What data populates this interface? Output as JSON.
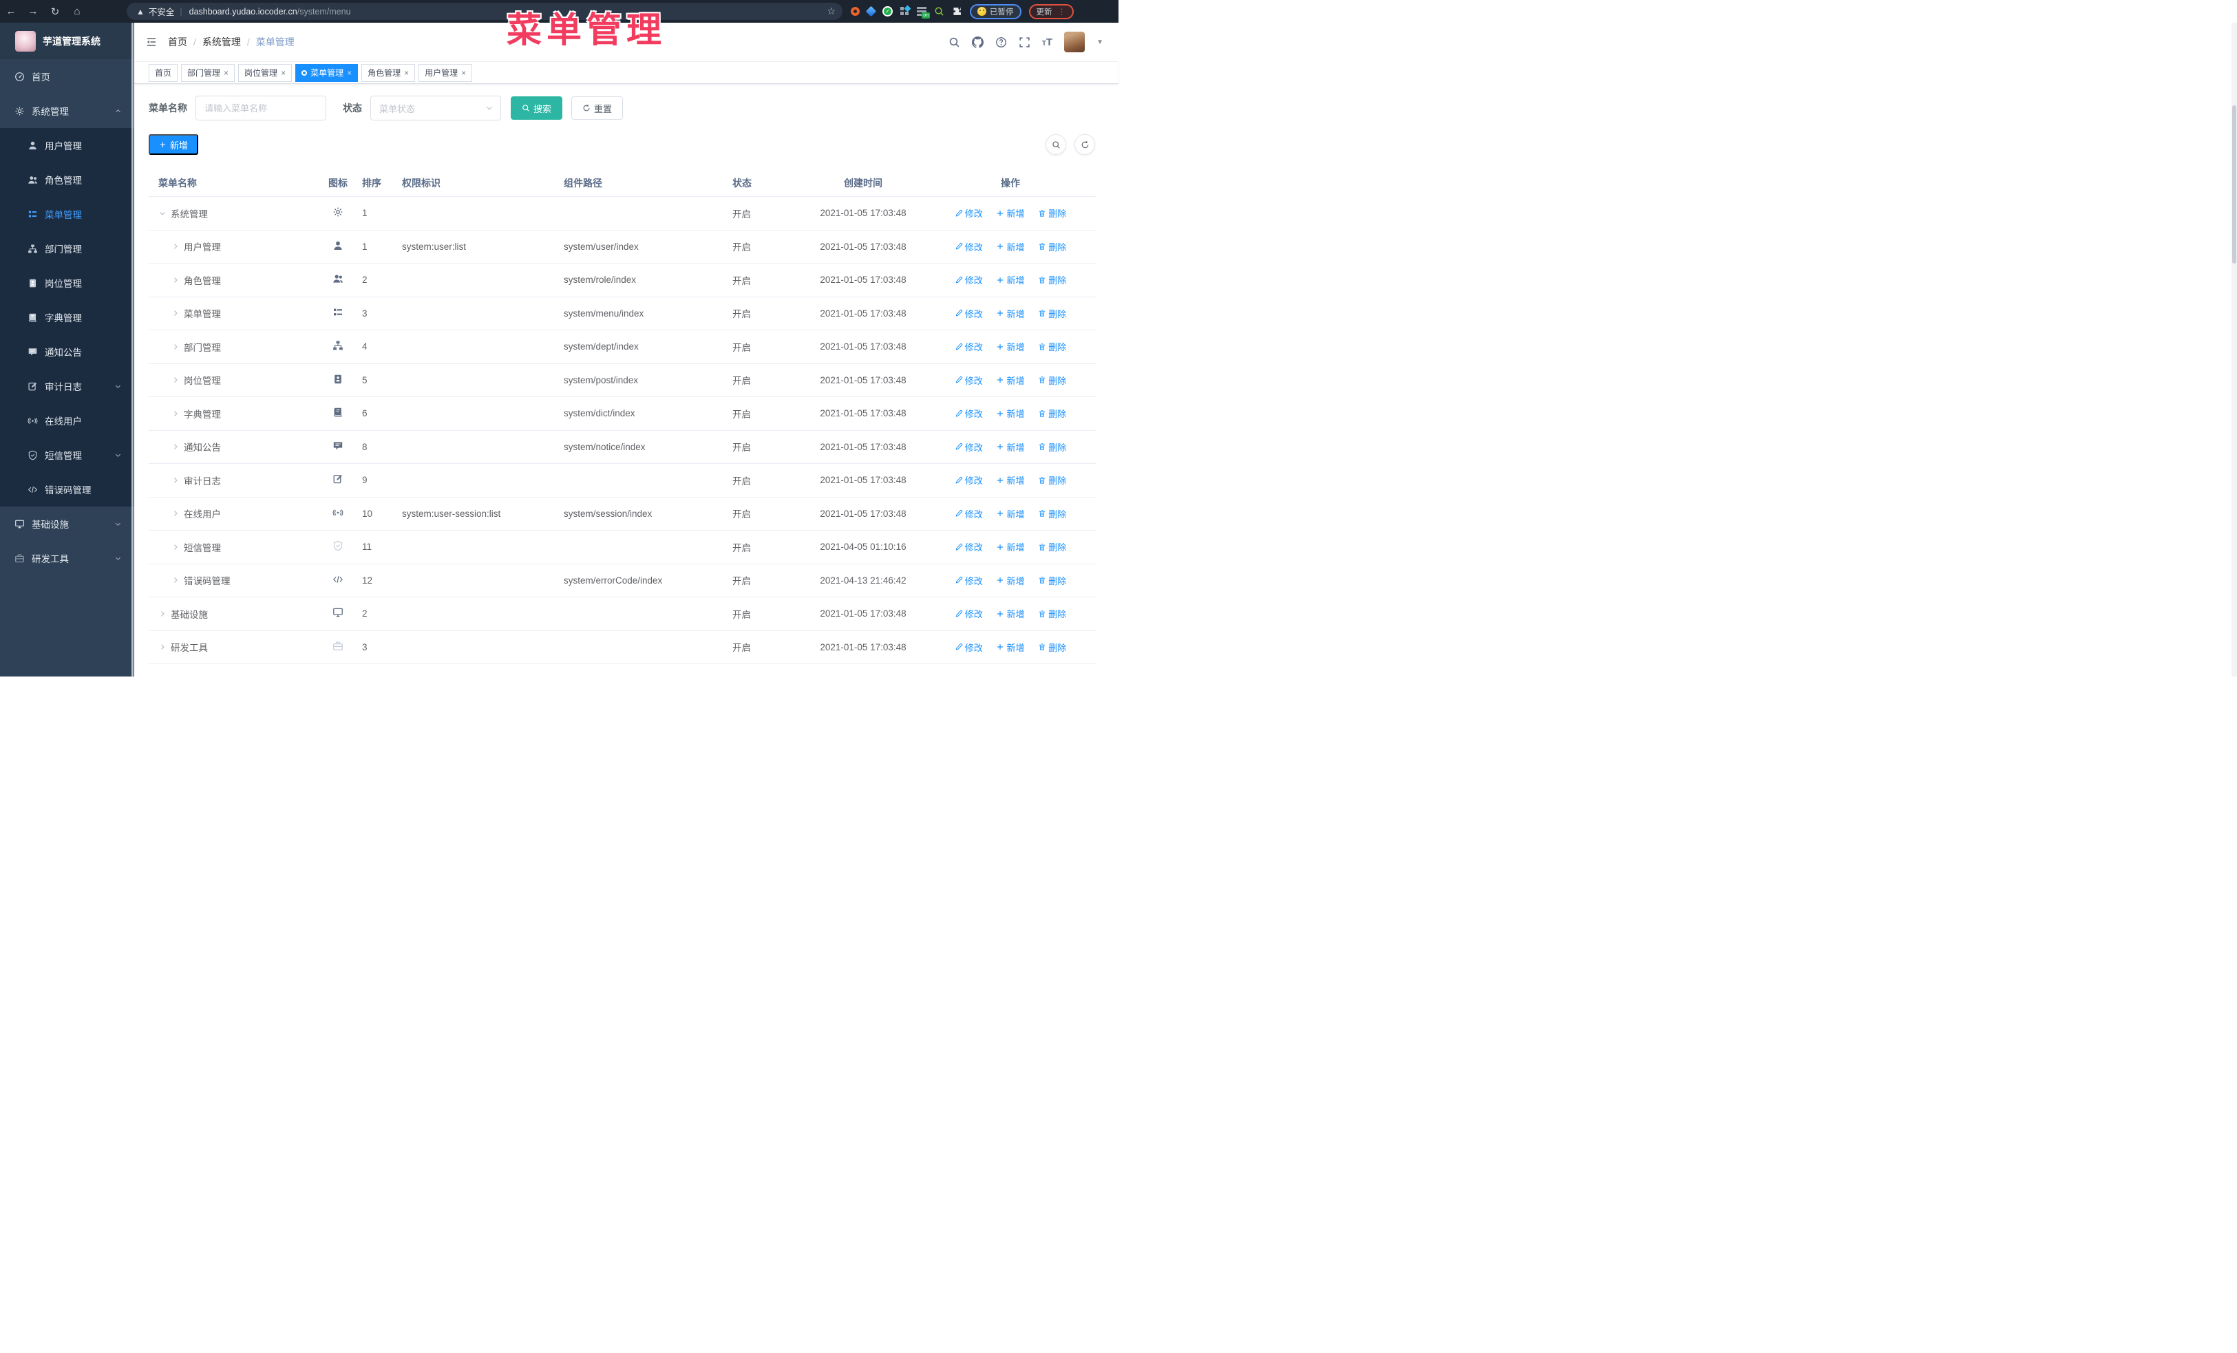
{
  "browser": {
    "security_warning": "不安全",
    "url_host": "dashboard.yudao.iocoder.cn",
    "url_path": "/system/menu",
    "paused_badge": "已暂停",
    "update_badge": "更新",
    "on_badge": "on"
  },
  "annotation": {
    "title": "菜单管理"
  },
  "colors": {
    "primary": "#1890ff",
    "sidebar_active": "#409eff",
    "search_button": "#2cb6a3",
    "annotation_pink": "#f13c5f"
  },
  "sidebar": {
    "logo_title": "芋道管理系统",
    "items": [
      {
        "label": "首页",
        "icon": "dashboard",
        "level": 0,
        "active": false,
        "caret": "",
        "light": false
      },
      {
        "label": "系统管理",
        "icon": "gear",
        "level": 0,
        "active": false,
        "caret": "up",
        "light": false
      },
      {
        "label": "用户管理",
        "icon": "user",
        "level": 1,
        "active": false,
        "caret": "",
        "light": false
      },
      {
        "label": "角色管理",
        "icon": "users",
        "level": 1,
        "active": false,
        "caret": "",
        "light": false
      },
      {
        "label": "菜单管理",
        "icon": "menulist",
        "level": 1,
        "active": true,
        "caret": "",
        "light": false
      },
      {
        "label": "部门管理",
        "icon": "tree",
        "level": 1,
        "active": false,
        "caret": "",
        "light": false
      },
      {
        "label": "岗位管理",
        "icon": "post",
        "level": 1,
        "active": false,
        "caret": "",
        "light": false
      },
      {
        "label": "字典管理",
        "icon": "dict",
        "level": 1,
        "active": false,
        "caret": "",
        "light": false
      },
      {
        "label": "通知公告",
        "icon": "message",
        "level": 1,
        "active": false,
        "caret": "",
        "light": false
      },
      {
        "label": "审计日志",
        "icon": "log",
        "level": 1,
        "active": false,
        "caret": "down",
        "light": false
      },
      {
        "label": "在线用户",
        "icon": "online",
        "level": 1,
        "active": false,
        "caret": "",
        "light": false
      },
      {
        "label": "短信管理",
        "icon": "sms",
        "level": 1,
        "active": false,
        "caret": "down",
        "light": false
      },
      {
        "label": "错误码管理",
        "icon": "code",
        "level": 1,
        "active": false,
        "caret": "",
        "light": false
      },
      {
        "label": "基础设施",
        "icon": "monitor",
        "level": 0,
        "active": false,
        "caret": "down",
        "light": false
      },
      {
        "label": "研发工具",
        "icon": "tool",
        "level": 0,
        "active": false,
        "caret": "down",
        "light": true
      }
    ]
  },
  "header": {
    "breadcrumb": [
      "首页",
      "系统管理",
      "菜单管理"
    ]
  },
  "tabs": [
    {
      "label": "首页",
      "closable": false,
      "active": false
    },
    {
      "label": "部门管理",
      "closable": true,
      "active": false
    },
    {
      "label": "岗位管理",
      "closable": true,
      "active": false
    },
    {
      "label": "菜单管理",
      "closable": true,
      "active": true
    },
    {
      "label": "角色管理",
      "closable": true,
      "active": false
    },
    {
      "label": "用户管理",
      "closable": true,
      "active": false
    }
  ],
  "filters": {
    "name_label": "菜单名称",
    "name_placeholder": "请输入菜单名称",
    "status_label": "状态",
    "status_placeholder": "菜单状态",
    "search_label": "搜索",
    "reset_label": "重置"
  },
  "toolbar": {
    "add_label": "新增"
  },
  "table": {
    "columns": [
      "菜单名称",
      "图标",
      "排序",
      "权限标识",
      "组件路径",
      "状态",
      "创建时间",
      "操作"
    ],
    "actions": {
      "edit": "修改",
      "add": "新增",
      "delete": "删除"
    },
    "rows": [
      {
        "name": "系统管理",
        "level": 0,
        "expanded": true,
        "icon": "gear",
        "light": false,
        "sort": "1",
        "perm": "",
        "path": "",
        "status": "开启",
        "created": "2021-01-05 17:03:48"
      },
      {
        "name": "用户管理",
        "level": 1,
        "expanded": false,
        "icon": "user",
        "light": false,
        "sort": "1",
        "perm": "system:user:list",
        "path": "system/user/index",
        "status": "开启",
        "created": "2021-01-05 17:03:48"
      },
      {
        "name": "角色管理",
        "level": 1,
        "expanded": false,
        "icon": "users",
        "light": false,
        "sort": "2",
        "perm": "",
        "path": "system/role/index",
        "status": "开启",
        "created": "2021-01-05 17:03:48"
      },
      {
        "name": "菜单管理",
        "level": 1,
        "expanded": false,
        "icon": "menulist",
        "light": false,
        "sort": "3",
        "perm": "",
        "path": "system/menu/index",
        "status": "开启",
        "created": "2021-01-05 17:03:48"
      },
      {
        "name": "部门管理",
        "level": 1,
        "expanded": false,
        "icon": "tree",
        "light": false,
        "sort": "4",
        "perm": "",
        "path": "system/dept/index",
        "status": "开启",
        "created": "2021-01-05 17:03:48"
      },
      {
        "name": "岗位管理",
        "level": 1,
        "expanded": false,
        "icon": "post",
        "light": false,
        "sort": "5",
        "perm": "",
        "path": "system/post/index",
        "status": "开启",
        "created": "2021-01-05 17:03:48"
      },
      {
        "name": "字典管理",
        "level": 1,
        "expanded": false,
        "icon": "dict",
        "light": false,
        "sort": "6",
        "perm": "",
        "path": "system/dict/index",
        "status": "开启",
        "created": "2021-01-05 17:03:48"
      },
      {
        "name": "通知公告",
        "level": 1,
        "expanded": false,
        "icon": "message",
        "light": false,
        "sort": "8",
        "perm": "",
        "path": "system/notice/index",
        "status": "开启",
        "created": "2021-01-05 17:03:48"
      },
      {
        "name": "审计日志",
        "level": 1,
        "expanded": false,
        "icon": "log",
        "light": false,
        "sort": "9",
        "perm": "",
        "path": "",
        "status": "开启",
        "created": "2021-01-05 17:03:48"
      },
      {
        "name": "在线用户",
        "level": 1,
        "expanded": false,
        "icon": "online",
        "light": false,
        "sort": "10",
        "perm": "system:user-session:list",
        "path": "system/session/index",
        "status": "开启",
        "created": "2021-01-05 17:03:48"
      },
      {
        "name": "短信管理",
        "level": 1,
        "expanded": false,
        "icon": "sms",
        "light": true,
        "sort": "11",
        "perm": "",
        "path": "",
        "status": "开启",
        "created": "2021-04-05 01:10:16"
      },
      {
        "name": "错误码管理",
        "level": 1,
        "expanded": false,
        "icon": "code",
        "light": false,
        "sort": "12",
        "perm": "",
        "path": "system/errorCode/index",
        "status": "开启",
        "created": "2021-04-13 21:46:42"
      },
      {
        "name": "基础设施",
        "level": 0,
        "expanded": false,
        "icon": "monitor",
        "light": false,
        "sort": "2",
        "perm": "",
        "path": "",
        "status": "开启",
        "created": "2021-01-05 17:03:48"
      },
      {
        "name": "研发工具",
        "level": 0,
        "expanded": false,
        "icon": "tool",
        "light": true,
        "sort": "3",
        "perm": "",
        "path": "",
        "status": "开启",
        "created": "2021-01-05 17:03:48"
      }
    ]
  }
}
